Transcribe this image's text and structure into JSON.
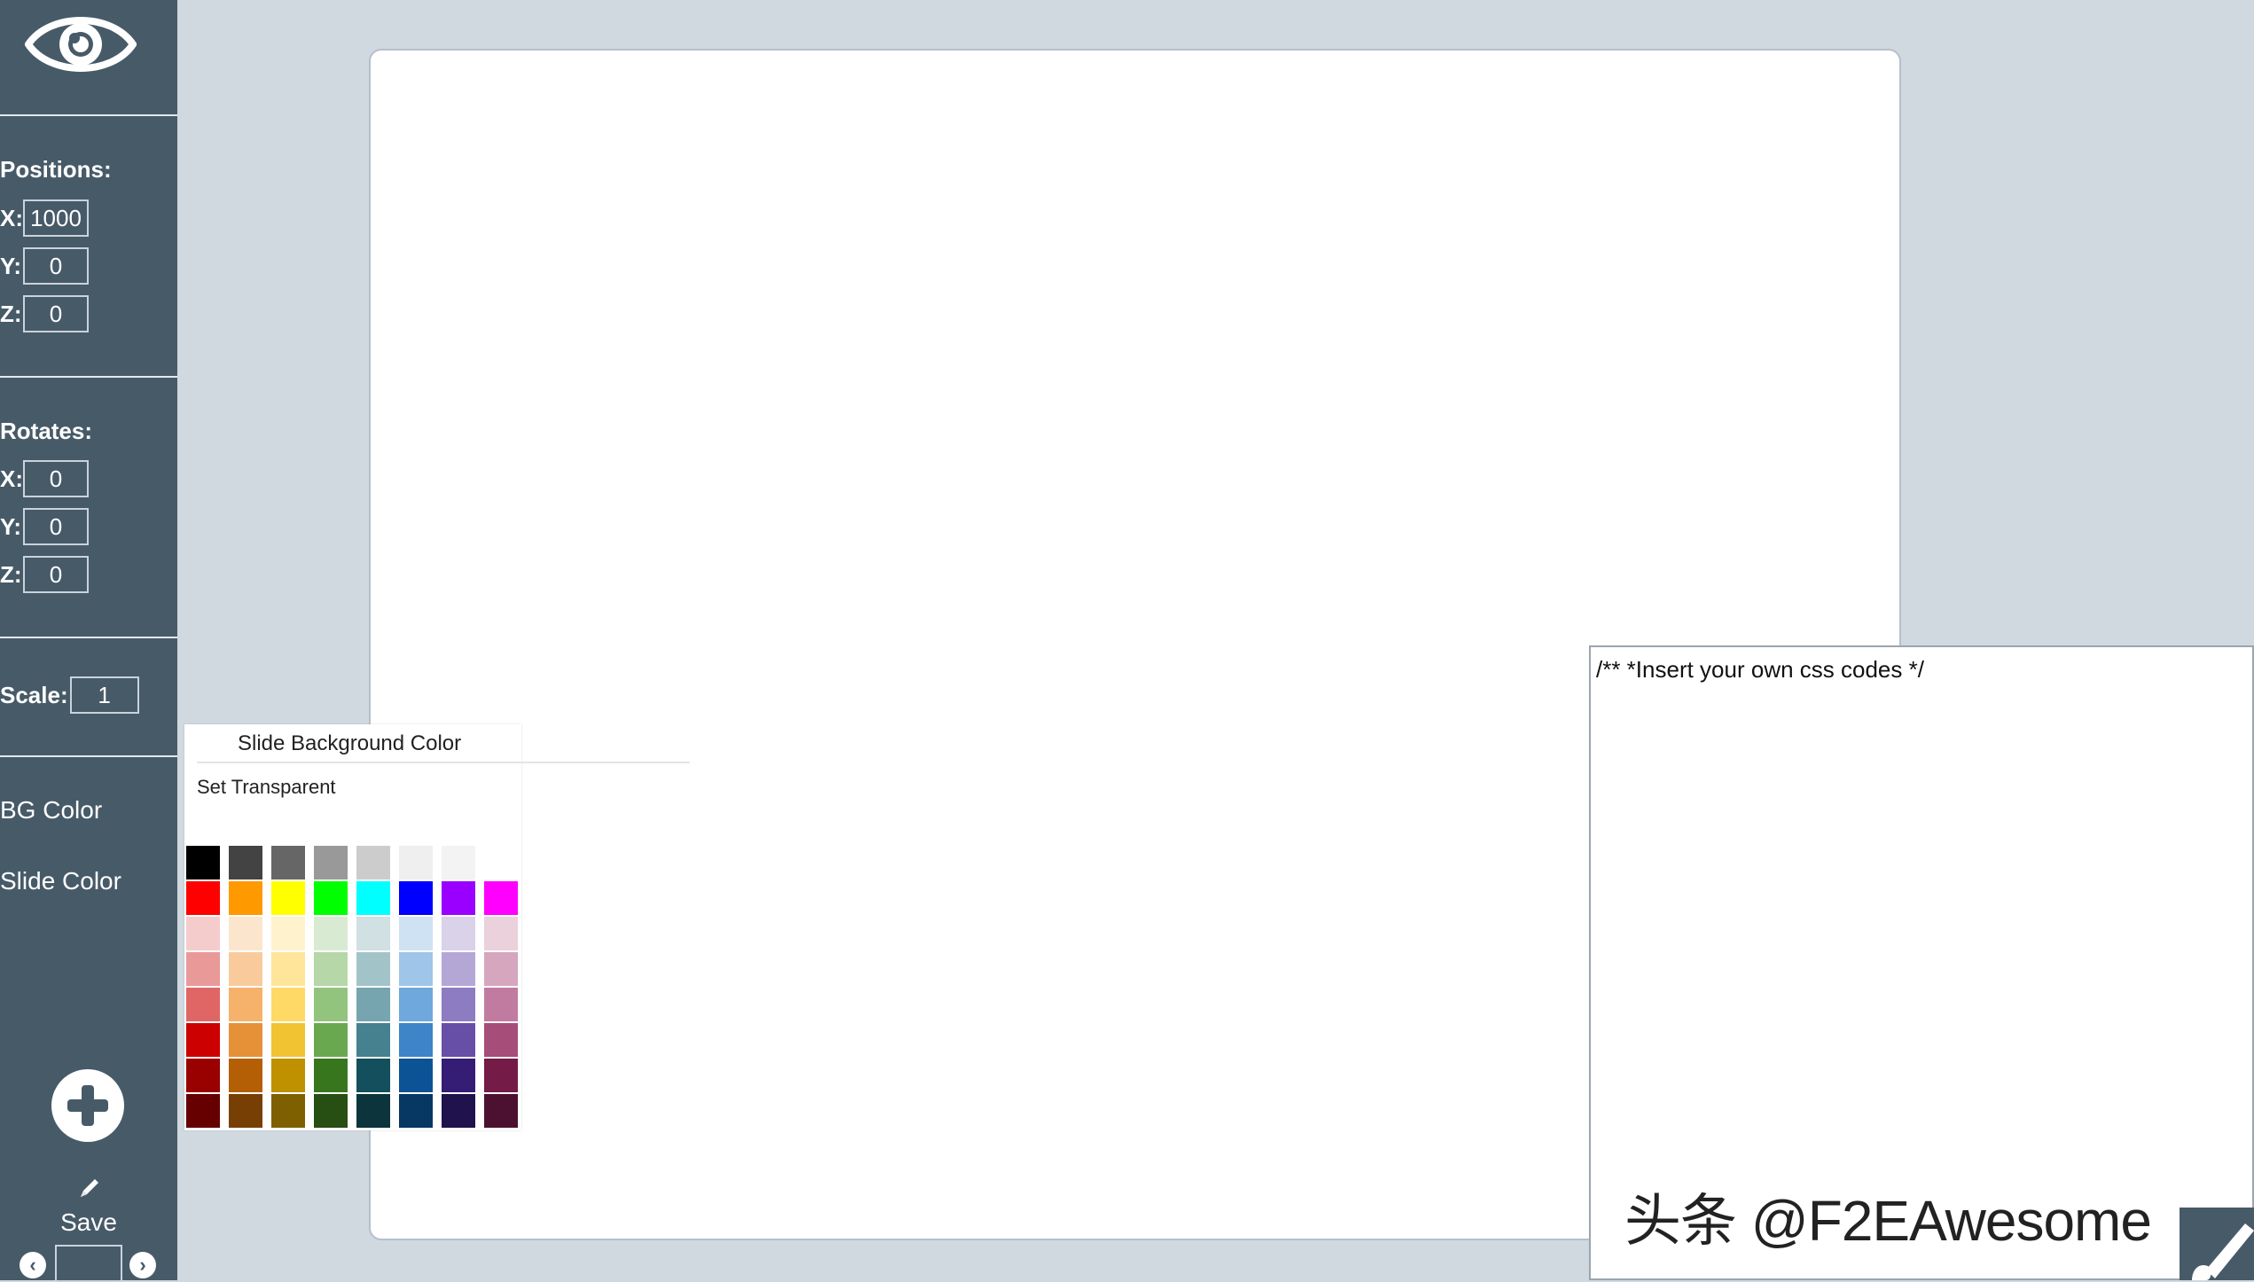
{
  "sidebar": {
    "eye_icon": "eye-icon",
    "positions": {
      "heading": "Positions:",
      "x_label": "X:",
      "x_value": "1000",
      "y_label": "Y:",
      "y_value": "0",
      "z_label": "Z:",
      "z_value": "0"
    },
    "rotates": {
      "heading": "Rotates:",
      "x_label": "X:",
      "x_value": "0",
      "y_label": "Y:",
      "y_value": "0",
      "z_label": "Z:",
      "z_value": "0"
    },
    "scale": {
      "label": "Scale:",
      "value": "1"
    },
    "bg_color_label": "BG Color",
    "slide_color_label": "Slide Color",
    "add_icon": "plus-icon",
    "save_icon": "pencil-icon",
    "save_label": "Save",
    "slide_number": ""
  },
  "color_picker": {
    "title": "Slide Background Color",
    "set_transparent": "Set Transparent",
    "swatches": [
      [
        "#000000",
        "#434343",
        "#666666",
        "#999999",
        "#cccccc",
        "#efefef",
        "#f3f3f3",
        "#ffffff"
      ],
      [
        "#ff0000",
        "#ff9900",
        "#ffff00",
        "#00ff00",
        "#00ffff",
        "#0000ff",
        "#9900ff",
        "#ff00ff"
      ],
      [
        "#f4cccc",
        "#fce5cd",
        "#fff2cc",
        "#d9ead3",
        "#d0e0e3",
        "#cfe2f3",
        "#d9d2e9",
        "#ead1dc"
      ],
      [
        "#ea9999",
        "#f9cb9c",
        "#ffe599",
        "#b6d7a8",
        "#a2c4c9",
        "#9fc5e8",
        "#b4a7d6",
        "#d5a6bd"
      ],
      [
        "#e06666",
        "#f6b26b",
        "#ffd966",
        "#93c47d",
        "#76a5af",
        "#6fa8dc",
        "#8e7cc3",
        "#c27ba0"
      ],
      [
        "#cc0000",
        "#e69138",
        "#f1c232",
        "#6aa84f",
        "#45818e",
        "#3d85c6",
        "#674ea7",
        "#a64d79"
      ],
      [
        "#990000",
        "#b45f06",
        "#bf9000",
        "#38761d",
        "#134f5c",
        "#0b5394",
        "#351c75",
        "#741b47"
      ],
      [
        "#660000",
        "#783f04",
        "#7f6000",
        "#274e13",
        "#0c343d",
        "#073763",
        "#20124d",
        "#4c1130"
      ]
    ]
  },
  "css_editor": {
    "text": "/** *Insert your own css codes */"
  },
  "watermark": "头条 @F2EAwesome",
  "colors": {
    "sidebar_bg": "#475a68",
    "workspace_bg": "#d0d8e0",
    "slide_bg": "#ffffff"
  }
}
